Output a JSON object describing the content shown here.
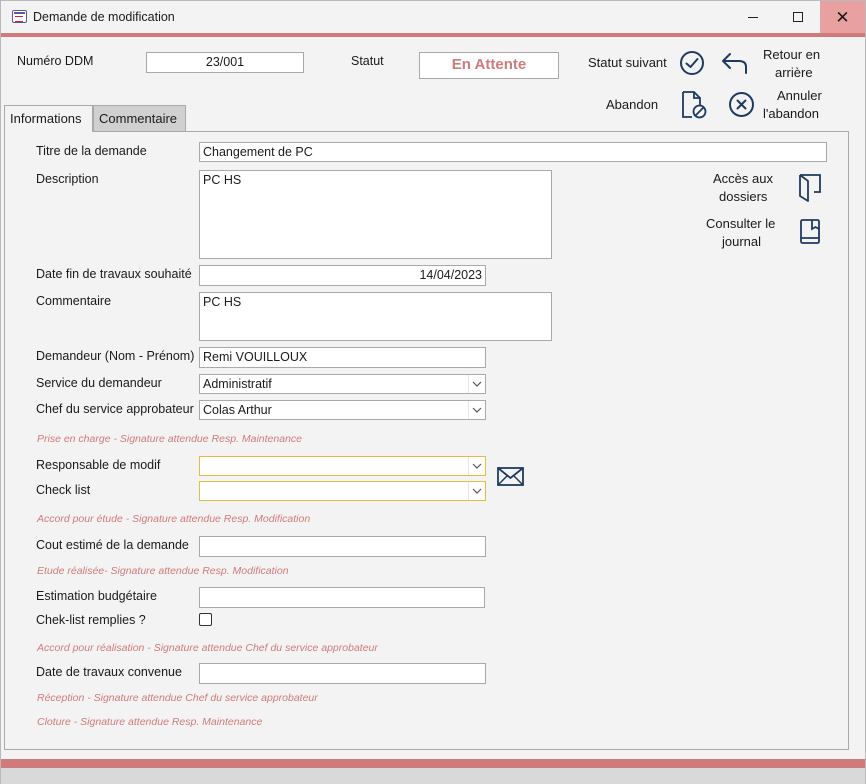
{
  "window": {
    "title": "Demande de modification"
  },
  "header": {
    "ddm_label": "Numéro DDM",
    "ddm_value": "23/001",
    "statut_label": "Statut",
    "statut_value": "En Attente",
    "status_color": "#d07b7b"
  },
  "actions": {
    "statut_suivant": "Statut suivant",
    "retour_line1": "Retour en",
    "retour_line2": "arrière",
    "abandon": "Abandon",
    "annuler_line1": "Annuler",
    "annuler_line2": "l'abandon",
    "acces_line1": "Accès aux",
    "acces_line2": "dossiers",
    "consulter_line1": "Consulter le",
    "consulter_line2": "journal"
  },
  "tabs": [
    {
      "label": "Informations",
      "active": true
    },
    {
      "label": "Commentaire",
      "active": false
    }
  ],
  "form": {
    "titre_label": "Titre de la demande",
    "titre_value": "Changement de PC",
    "description_label": "Description",
    "description_value": "PC HS",
    "date_fin_label": "Date fin de travaux souhaité",
    "date_fin_value": "14/04/2023",
    "commentaire_label": "Commentaire",
    "commentaire_value": "PC HS",
    "demandeur_label": "Demandeur (Nom - Prénom)",
    "demandeur_value": "Remi VOUILLOUX",
    "service_label": "Service du demandeur",
    "service_value": "Administratif",
    "chef_label": "Chef du service approbateur",
    "chef_value": "Colas Arthur",
    "section_prise": "Prise en charge - Signature attendue Resp. Maintenance",
    "responsable_label": "Responsable de modif",
    "responsable_value": "",
    "checklist_label": "Check list",
    "checklist_value": "",
    "section_accord_etude": "Accord pour étude - Signature attendue Resp. Modification",
    "cout_label": "Cout estimé de la demande",
    "cout_value": "",
    "section_etude": "Etude réalisée- Signature attendue Resp. Modification",
    "estimation_label": "Estimation budgétaire",
    "estimation_value": "",
    "chek_label": "Chek-list remplies ?",
    "chek_checked": false,
    "section_accord_real": "Accord pour réalisation - Signature attendue Chef du service approbateur",
    "date_convenue_label": "Date de travaux convenue",
    "date_convenue_value": "",
    "section_reception": "Réception - Signature attendue Chef du service approbateur",
    "section_cloture": "Cloture - Signature attendue Resp. Maintenance"
  },
  "icons": {
    "check": "check-circle-icon",
    "undo": "undo-arrow-icon",
    "abandon": "document-cancel-icon",
    "cancel": "x-circle-icon",
    "folder": "folder-icon",
    "journal": "journal-icon",
    "mail": "envelope-icon"
  }
}
